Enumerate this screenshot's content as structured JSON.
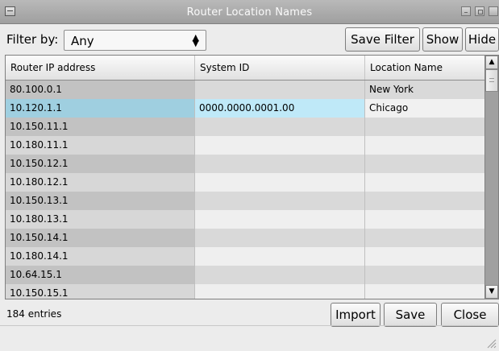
{
  "window": {
    "title": "Router Location Names"
  },
  "filter": {
    "label": "Filter by:",
    "selected": "Any"
  },
  "toolbar": {
    "save_filter": "Save Filter",
    "show": "Show",
    "hide": "Hide"
  },
  "table": {
    "columns": [
      "Router IP address",
      "System ID",
      "Location Name"
    ],
    "rows": [
      {
        "ip": "80.100.0.1",
        "system_id": "",
        "location": "New York"
      },
      {
        "ip": "10.120.1.1",
        "system_id": "0000.0000.0001.00",
        "location": "Chicago",
        "selected": true
      },
      {
        "ip": "10.150.11.1",
        "system_id": "",
        "location": ""
      },
      {
        "ip": "10.180.11.1",
        "system_id": "",
        "location": ""
      },
      {
        "ip": "10.150.12.1",
        "system_id": "",
        "location": ""
      },
      {
        "ip": "10.180.12.1",
        "system_id": "",
        "location": ""
      },
      {
        "ip": "10.150.13.1",
        "system_id": "",
        "location": ""
      },
      {
        "ip": "10.180.13.1",
        "system_id": "",
        "location": ""
      },
      {
        "ip": "10.150.14.1",
        "system_id": "",
        "location": ""
      },
      {
        "ip": "10.180.14.1",
        "system_id": "",
        "location": ""
      },
      {
        "ip": "10.64.15.1",
        "system_id": "",
        "location": ""
      },
      {
        "ip": "10.150.15.1",
        "system_id": "",
        "location": ""
      }
    ]
  },
  "status": {
    "entries": "184 entries"
  },
  "footer": {
    "import": "Import",
    "save": "Save",
    "close": "Close"
  }
}
